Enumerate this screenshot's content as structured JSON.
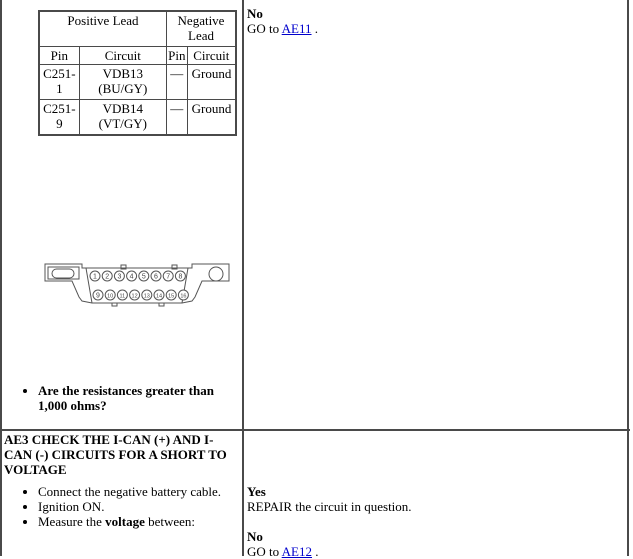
{
  "lead_table": {
    "header": {
      "positive_lead": "Positive Lead",
      "negative_lead": "Negative Lead",
      "pin": "Pin",
      "circuit": "Circuit",
      "neg_pin": "Pin",
      "neg_circuit": "Circuit"
    },
    "rows": [
      {
        "pin": "C251-1",
        "circuit": "VDB13 (BU/GY)",
        "neg_pin": "—",
        "neg_circuit": "Ground"
      },
      {
        "pin": "C251-9",
        "circuit": "VDB14 (VT/GY)",
        "neg_pin": "—",
        "neg_circuit": "Ground"
      }
    ]
  },
  "connector": {
    "icon": "obd-connector-icon",
    "pins_top": [
      "1",
      "2",
      "3",
      "4",
      "5",
      "6",
      "7",
      "8"
    ],
    "pins_bottom": [
      "9",
      "10",
      "11",
      "12",
      "13",
      "14",
      "15",
      "16"
    ]
  },
  "step_ae2": {
    "question": "Are the resistances greater than 1,000 ohms?",
    "no_label": "No",
    "no_text_prefix": "GO to ",
    "no_link": "AE11",
    "no_text_suffix": " ."
  },
  "step_ae3": {
    "title": "AE3 CHECK THE I-CAN (+) AND I-CAN (-) CIRCUITS FOR A SHORT TO VOLTAGE",
    "instructions": [
      {
        "text": "Connect the negative battery cable."
      },
      {
        "text": "Ignition ON."
      },
      {
        "prefix": "Measure the ",
        "bold": "voltage",
        "suffix": " between:"
      }
    ],
    "yes_label": "Yes",
    "yes_text": "REPAIR the circuit in question.",
    "no_label": "No",
    "no_text_prefix": "GO to ",
    "no_link": "AE12",
    "no_text_suffix": " ."
  }
}
